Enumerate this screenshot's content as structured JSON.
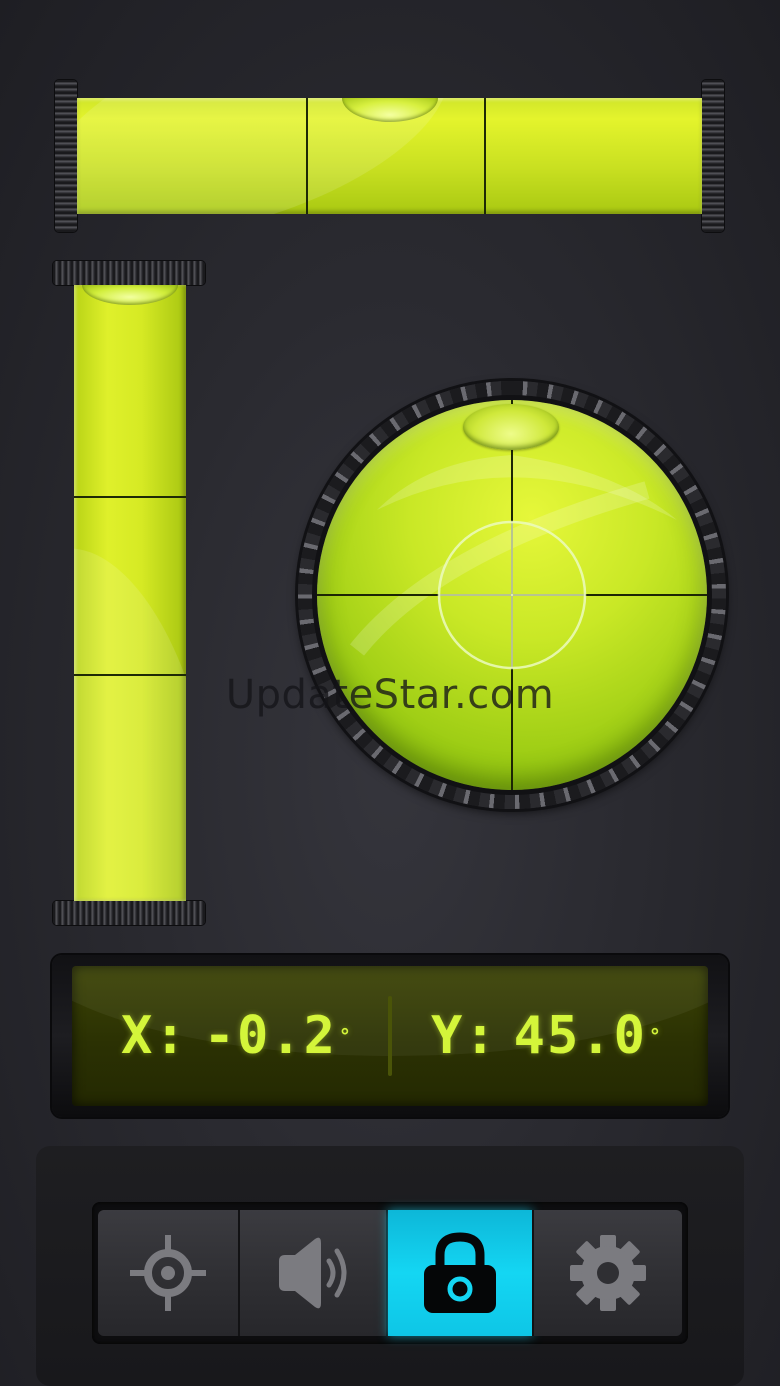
{
  "readout": {
    "x_label": "X:",
    "x_value": "-0.2",
    "y_label": "Y:",
    "y_value": "45.0",
    "degree": "°"
  },
  "toolbar": {
    "items": [
      {
        "icon": "crosshair-icon",
        "active": false
      },
      {
        "icon": "speaker-icon",
        "active": false
      },
      {
        "icon": "lock-icon",
        "active": true
      },
      {
        "icon": "gear-icon",
        "active": false
      }
    ]
  },
  "watermark": "UpdateStar.com",
  "colors": {
    "liquid": "#cfe52a",
    "digits": "#d4f53a",
    "active_button": "#14d6f3",
    "background": "#2a2a30"
  }
}
